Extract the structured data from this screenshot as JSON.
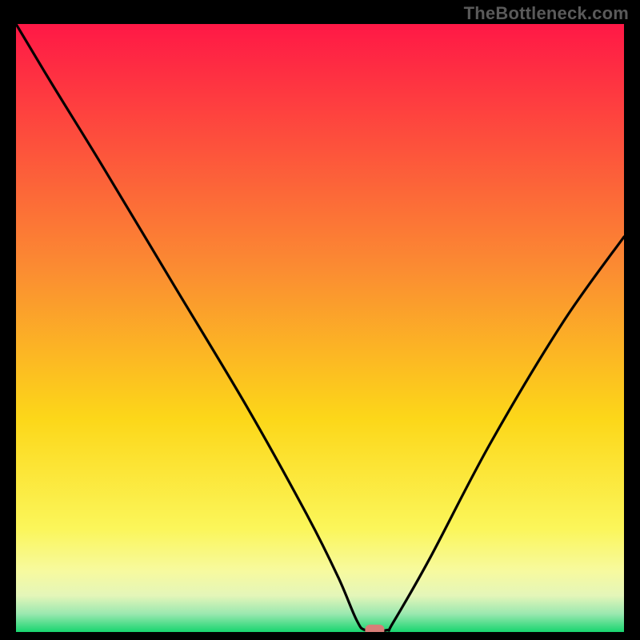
{
  "watermark": "TheBottleneck.com",
  "chart_data": {
    "type": "line",
    "title": "",
    "xlabel": "",
    "ylabel": "",
    "xlim": [
      0,
      100
    ],
    "ylim": [
      0,
      100
    ],
    "grid": false,
    "legend": false,
    "background": "red-yellow-green vertical gradient",
    "series": [
      {
        "name": "bottleneck-curve",
        "x": [
          0,
          6,
          14,
          26,
          38,
          48,
          53,
          56,
          57.5,
          61,
          62,
          68,
          78,
          90,
          100
        ],
        "y": [
          100,
          90,
          77,
          57,
          37,
          19,
          9,
          2,
          0.3,
          0.3,
          1.5,
          12,
          31,
          51,
          65
        ]
      }
    ],
    "marker": {
      "name": "optimal-point",
      "x": 59,
      "y": 0.3,
      "color": "#d77e78",
      "shape": "rounded-rect"
    },
    "gradient_stops": [
      {
        "offset": 0,
        "color": "#ff1846"
      },
      {
        "offset": 40,
        "color": "#fb8b32"
      },
      {
        "offset": 65,
        "color": "#fcd719"
      },
      {
        "offset": 83,
        "color": "#fbf65a"
      },
      {
        "offset": 90,
        "color": "#f7fa9f"
      },
      {
        "offset": 94,
        "color": "#e4f6b9"
      },
      {
        "offset": 97,
        "color": "#9be8b0"
      },
      {
        "offset": 100,
        "color": "#18d56f"
      }
    ]
  }
}
